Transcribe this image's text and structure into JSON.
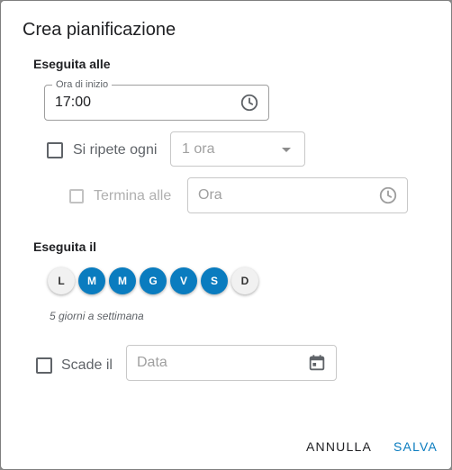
{
  "dialog": {
    "title": "Crea pianificazione",
    "run_at_label": "Eseguita alle",
    "start_time": {
      "legend": "Ora di inizio",
      "value": "17:00",
      "icon": "clock-icon"
    },
    "repeat": {
      "label": "Si ripete ogni",
      "checked": false,
      "select_value": "1 ora",
      "icon": "chevron-down-icon"
    },
    "end_at": {
      "label": "Termina alle",
      "checked": false,
      "placeholder": "Ora",
      "icon": "clock-icon"
    },
    "run_on_label": "Eseguita il",
    "days": [
      {
        "label": "L",
        "selected": false
      },
      {
        "label": "M",
        "selected": true
      },
      {
        "label": "M",
        "selected": true
      },
      {
        "label": "G",
        "selected": true
      },
      {
        "label": "V",
        "selected": true
      },
      {
        "label": "S",
        "selected": true
      },
      {
        "label": "D",
        "selected": false
      }
    ],
    "days_summary": "5 giorni a settimana",
    "expires": {
      "label": "Scade il",
      "checked": false,
      "placeholder": "Data",
      "icon": "calendar-icon"
    },
    "cancel_label": "ANNULLA",
    "save_label": "SALVA"
  },
  "colors": {
    "accent": "#0a7cbf",
    "day_off": "#f1f1f1",
    "text": "#202124",
    "muted": "#5f6368"
  }
}
